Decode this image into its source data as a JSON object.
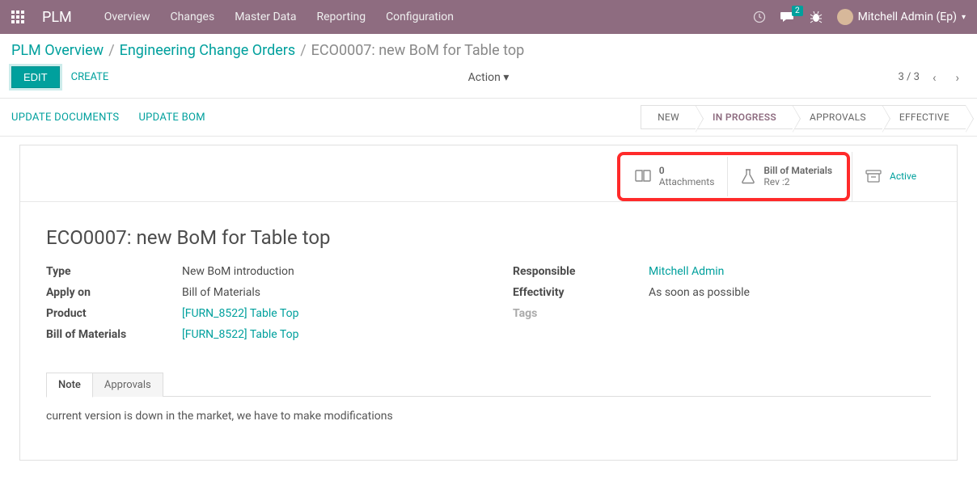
{
  "brand": "PLM",
  "nav": {
    "overview": "Overview",
    "changes": "Changes",
    "master": "Master Data",
    "reporting": "Reporting",
    "config": "Configuration"
  },
  "msg_count": "2",
  "user_name": "Mitchell Admin (Ep)",
  "breadcrumb": {
    "a": "PLM Overview",
    "b": "Engineering Change Orders",
    "c": "ECO0007: new BoM for Table top"
  },
  "buttons": {
    "edit": "EDIT",
    "create": "CREATE",
    "action": "Action",
    "upd_docs": "UPDATE DOCUMENTS",
    "upd_bom": "UPDATE BOM"
  },
  "pager": "3 / 3",
  "stages": {
    "new": "NEW",
    "inprog": "IN PROGRESS",
    "appr": "APPROVALS",
    "eff": "EFFECTIVE"
  },
  "stats": {
    "attach_top": "0",
    "attach_bot": "Attachments",
    "bom_top": "Bill of Materials",
    "bom_bot": "Rev :2",
    "active": "Active"
  },
  "title": "ECO0007: new BoM for Table top",
  "fields": {
    "type_l": "Type",
    "type_v": "New BoM introduction",
    "apply_l": "Apply on",
    "apply_v": "Bill of Materials",
    "prod_l": "Product",
    "prod_v": "[FURN_8522] Table Top",
    "bom_l": "Bill of Materials",
    "bom_v": "[FURN_8522] Table Top",
    "resp_l": "Responsible",
    "resp_v": "Mitchell Admin",
    "eff_l": "Effectivity",
    "eff_v": "As soon as possible",
    "tags_l": "Tags"
  },
  "tabs": {
    "note": "Note",
    "appr": "Approvals"
  },
  "note_body": "current version is down in the market, we have to make modifications"
}
